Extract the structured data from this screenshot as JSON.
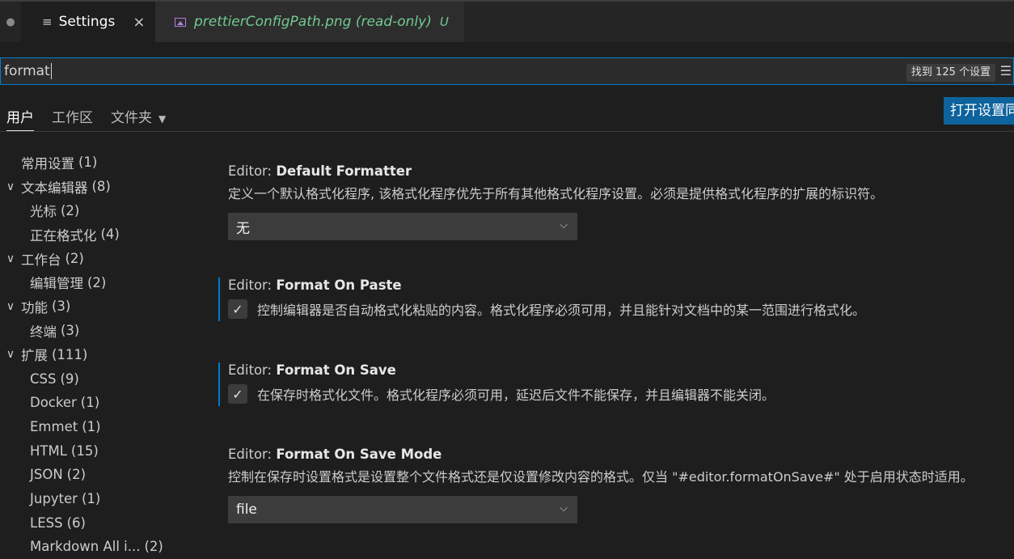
{
  "tabs": [
    {
      "label": "Settings",
      "close": "×"
    },
    {
      "label": "prettierConfigPath.png (read-only)",
      "status": "U"
    }
  ],
  "search": {
    "value": "format",
    "count": "找到 125 个设置"
  },
  "scopes": {
    "user": "用户",
    "workspace": "工作区",
    "folder": "文件夹"
  },
  "sync_button": "打开设置同",
  "toc": [
    {
      "label": "常用设置",
      "count": "(1)"
    },
    {
      "label": "文本编辑器",
      "count": "(8)"
    },
    {
      "label": "光标",
      "count": "(2)"
    },
    {
      "label": "正在格式化",
      "count": "(4)"
    },
    {
      "label": "工作台",
      "count": "(2)"
    },
    {
      "label": "编辑管理",
      "count": "(2)"
    },
    {
      "label": "功能",
      "count": "(3)"
    },
    {
      "label": "终端",
      "count": "(3)"
    },
    {
      "label": "扩展",
      "count": "(111)"
    },
    {
      "label": "CSS",
      "count": "(9)"
    },
    {
      "label": "Docker",
      "count": "(1)"
    },
    {
      "label": "Emmet",
      "count": "(1)"
    },
    {
      "label": "HTML",
      "count": "(15)"
    },
    {
      "label": "JSON",
      "count": "(2)"
    },
    {
      "label": "Jupyter",
      "count": "(1)"
    },
    {
      "label": "LESS",
      "count": "(6)"
    },
    {
      "label": "Markdown All i...",
      "count": "(2)"
    }
  ],
  "settings": {
    "default_formatter": {
      "prefix": "Editor: ",
      "name": "Default Formatter",
      "desc": "定义一个默认格式化程序, 该格式化程序优先于所有其他格式化程序设置。必须是提供格式化程序的扩展的标识符。",
      "value": "无"
    },
    "format_on_paste": {
      "prefix": "Editor: ",
      "name": "Format On Paste",
      "desc": "控制编辑器是否自动格式化粘贴的内容。格式化程序必须可用，并且能针对文档中的某一范围进行格式化。",
      "check": "✓"
    },
    "format_on_save": {
      "prefix": "Editor: ",
      "name": "Format On Save",
      "desc": "在保存时格式化文件。格式化程序必须可用，延迟后文件不能保存，并且编辑器不能关闭。",
      "check": "✓"
    },
    "format_on_save_mode": {
      "prefix": "Editor: ",
      "name": "Format On Save Mode",
      "desc": "控制在保存时设置格式是设置整个文件格式还是仅设置修改内容的格式。仅当 \"#editor.formatOnSave#\" 处于启用状态时适用。",
      "value": "file"
    }
  },
  "colors": {
    "accent": "#007acc",
    "button": "#0e639c",
    "untracked": "#73c991"
  }
}
